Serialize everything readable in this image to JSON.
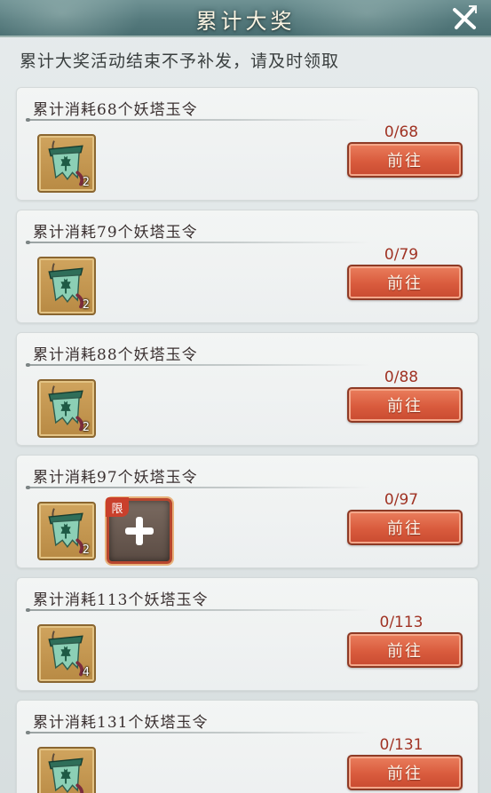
{
  "header": {
    "title": "累计大奖"
  },
  "notice": "累计大奖活动结束不予补发，请及时领取",
  "icons": {
    "close": "close-x-icon",
    "reward": "yao-tower-jade-token-icon",
    "plus": "plus-icon"
  },
  "colors": {
    "button": "#d95b3d",
    "progress": "#a03324",
    "header": "#557a7d"
  },
  "rewards": [
    {
      "title": "累计消耗68个妖塔玉令",
      "progress": "0/68",
      "item_count": "2",
      "button": "前往"
    },
    {
      "title": "累计消耗79个妖塔玉令",
      "progress": "0/79",
      "item_count": "2",
      "button": "前往"
    },
    {
      "title": "累计消耗88个妖塔玉令",
      "progress": "0/88",
      "item_count": "2",
      "button": "前往"
    },
    {
      "title": "累计消耗97个妖塔玉令",
      "progress": "0/97",
      "item_count": "2",
      "button": "前往",
      "limit_tag": "限"
    },
    {
      "title": "累计消耗113个妖塔玉令",
      "progress": "0/113",
      "item_count": "4",
      "button": "前往"
    },
    {
      "title": "累计消耗131个妖塔玉令",
      "progress": "0/131",
      "item_count": "",
      "button": "前往"
    }
  ]
}
